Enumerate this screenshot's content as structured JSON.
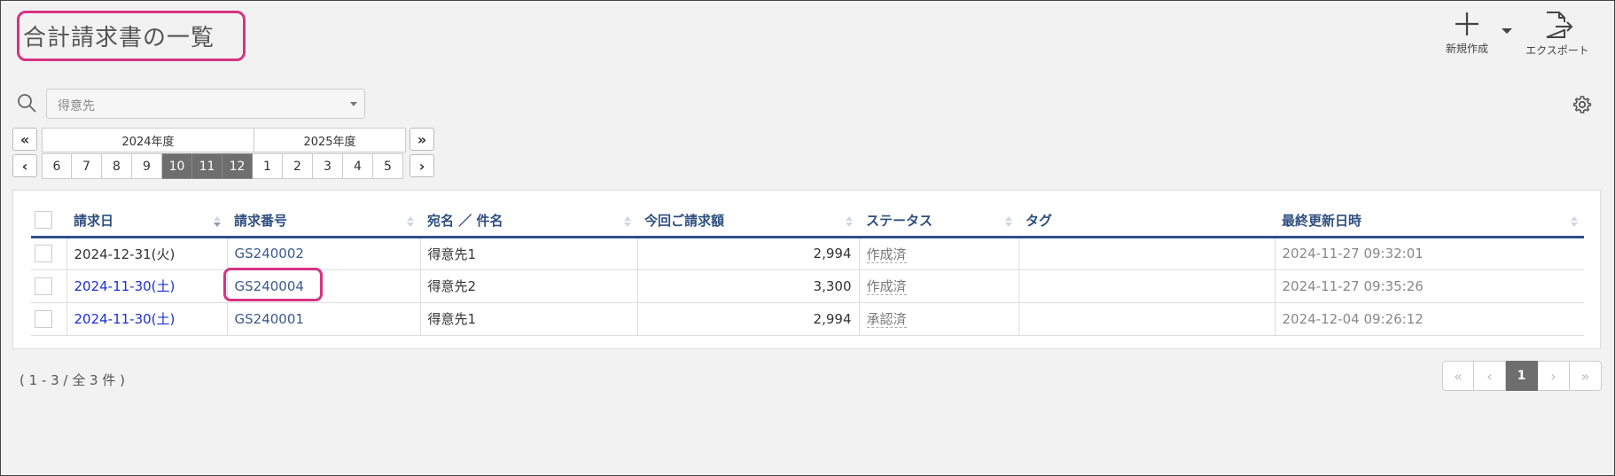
{
  "header": {
    "title": "合計請求書の一覧",
    "new_label": "新規作成",
    "export_label": "エクスポート"
  },
  "filter": {
    "placeholder": "得意先"
  },
  "period": {
    "prev_year_icon": "«",
    "next_year_icon": "»",
    "prev_icon": "‹",
    "next_icon": "›",
    "years": [
      "2024年度",
      "2025年度"
    ],
    "months": [
      "6",
      "7",
      "8",
      "9",
      "10",
      "11",
      "12",
      "1",
      "2",
      "3",
      "4",
      "5"
    ],
    "selected": [
      "10",
      "11",
      "12"
    ]
  },
  "table": {
    "columns": [
      "請求日",
      "請求番号",
      "宛名 ／ 件名",
      "今回ご請求額",
      "ステータス",
      "タグ",
      "最終更新日時"
    ],
    "rows": [
      {
        "date": "2024-12-31(火)",
        "number": "GS240002",
        "name": "得意先1",
        "amount": "2,994",
        "status": "作成済",
        "tag": "",
        "updated": "2024-11-27 09:32:01"
      },
      {
        "date": "2024-11-30(土)",
        "number": "GS240004",
        "name": "得意先2",
        "amount": "3,300",
        "status": "作成済",
        "tag": "",
        "updated": "2024-11-27 09:35:26"
      },
      {
        "date": "2024-11-30(土)",
        "number": "GS240001",
        "name": "得意先1",
        "amount": "2,994",
        "status": "承認済",
        "tag": "",
        "updated": "2024-12-04 09:26:12"
      }
    ]
  },
  "footer": {
    "count_text": "( 1 - 3 / 全 3 件 )",
    "pager": [
      "«",
      "‹",
      "1",
      "›",
      "»"
    ]
  },
  "colors": {
    "highlight": "#d63383",
    "header_text": "#2f4f7f",
    "link_blue": "#1a2fd8",
    "selected_month": "#6e6e6e"
  }
}
